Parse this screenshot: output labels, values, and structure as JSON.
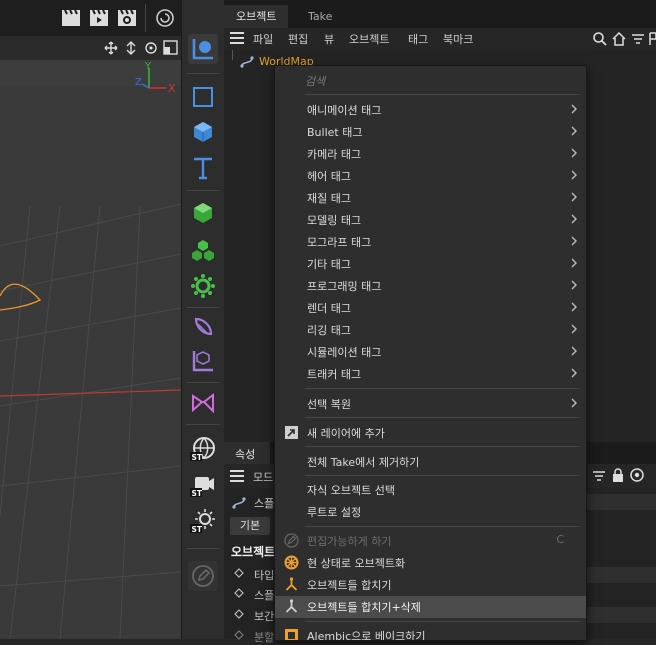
{
  "colors": {
    "accent_blue": "#4a90e2",
    "green": "#49c04a",
    "purple": "#a07bd8",
    "orange": "#f0a030",
    "axis_red": "#d8322c",
    "axis_green": "#2fbf3b",
    "axis_blue": "#3a6ee0"
  },
  "viewport": {
    "axis_labels": {
      "y": "Y",
      "z": "Z",
      "x": "X"
    }
  },
  "palette_icons": [
    "move-tool-icon",
    "rectangle-icon",
    "cube-icon",
    "text-icon",
    "green-cube-icon",
    "cloner-icon",
    "effector-icon",
    "deformer-icon",
    "spline-box-icon",
    "morph-icon",
    "world-st-icon",
    "camera-st-icon",
    "light-st-icon",
    "edit-disabled-icon"
  ],
  "tabs": {
    "objects": "오브젝트",
    "take": "Take"
  },
  "menubar": {
    "file": "파일",
    "edit": "편집",
    "view": "뷰",
    "object": "오브젝트",
    "tag": "태그",
    "bookmark": "북마크"
  },
  "object_list": {
    "item_name": "WorldMap"
  },
  "context_menu": {
    "search_placeholder": "검색",
    "items": [
      {
        "label": "애니메이션 태그",
        "submenu": true
      },
      {
        "label": "Bullet 태그",
        "submenu": true
      },
      {
        "label": "카메라 태그",
        "submenu": true
      },
      {
        "label": "헤어 태그",
        "submenu": true
      },
      {
        "label": "재질 태그",
        "submenu": true
      },
      {
        "label": "모델링 태그",
        "submenu": true
      },
      {
        "label": "모그라프 태그",
        "submenu": true
      },
      {
        "label": "기타 태그",
        "submenu": true
      },
      {
        "label": "프로그래밍 태그",
        "submenu": true
      },
      {
        "label": "렌더 태그",
        "submenu": true
      },
      {
        "label": "리깅 태그",
        "submenu": true
      },
      {
        "label": "시뮬레이션 태그",
        "submenu": true
      },
      {
        "label": "트래커 태그",
        "submenu": true
      }
    ],
    "restore_selection": "선택 복원",
    "add_to_new_layer": "새 레이어에 추가",
    "remove_from_all_takes": "전체 Take에서 제거하기",
    "select_children": "자식 오브젝트 선택",
    "set_as_root": "루트로 설정",
    "make_editable": "편집가능하게 하기",
    "make_editable_shortcut": "C",
    "current_state_to_object": "현 상태로 오브젝트화",
    "connect_objects": "오브젝트들 합치기",
    "connect_objects_delete": "오브젝트들 합치기+삭제",
    "bake_alembic": "Alembic으로 베이크하기"
  },
  "attributes": {
    "tab_label": "속성",
    "mode_label": "모드",
    "spline_label": "스플",
    "basic_tab": "기본",
    "section_title": "오브젝트",
    "rows": [
      "타입",
      "스플",
      "보간",
      "분할"
    ]
  }
}
